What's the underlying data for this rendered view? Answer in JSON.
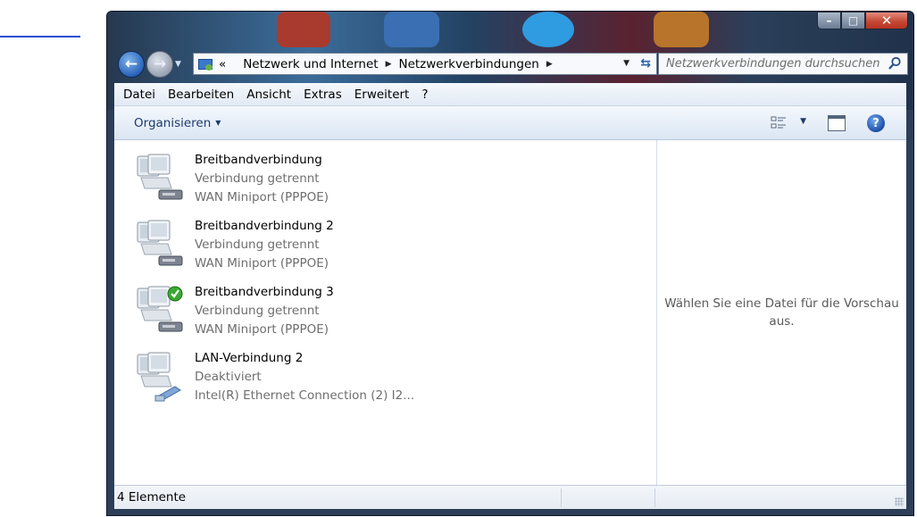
{
  "window": {
    "caption_minimize": "–",
    "caption_maximize": "□",
    "caption_close": "✕"
  },
  "nav": {
    "breadcrumb_prefix": "«",
    "breadcrumbs": [
      "Netzwerk und Internet",
      "Netzwerkverbindungen"
    ],
    "search_placeholder": "Netzwerkverbindungen durchsuchen"
  },
  "menu": [
    "Datei",
    "Bearbeiten",
    "Ansicht",
    "Extras",
    "Erweitert",
    "?"
  ],
  "toolbar": {
    "organize_label": "Organisieren",
    "help_label": "?"
  },
  "connections": [
    {
      "name": "Breitbandverbindung",
      "status": "Verbindung getrennt",
      "device": "WAN Miniport (PPPOE)",
      "icon": "broadband-connection-icon",
      "checked": false
    },
    {
      "name": "Breitbandverbindung 2",
      "status": "Verbindung getrennt",
      "device": "WAN Miniport (PPPOE)",
      "icon": "broadband-connection-icon",
      "checked": false
    },
    {
      "name": "Breitbandverbindung 3",
      "status": "Verbindung getrennt",
      "device": "WAN Miniport (PPPOE)",
      "icon": "broadband-connection-icon",
      "checked": true
    },
    {
      "name": "LAN-Verbindung 2",
      "status": "Deaktiviert",
      "device": "Intel(R) Ethernet Connection (2) I2...",
      "icon": "lan-connection-icon",
      "checked": false
    }
  ],
  "preview": {
    "message": "Wählen Sie eine Datei für die Vorschau aus."
  },
  "statusbar": {
    "item_count": "4 Elemente"
  },
  "colors": {
    "menu_bg": "#e3eaf4",
    "command_text": "#1e3b6e",
    "secondary_text": "#6e6e6e",
    "pen_stroke": "#1c4fd6"
  }
}
